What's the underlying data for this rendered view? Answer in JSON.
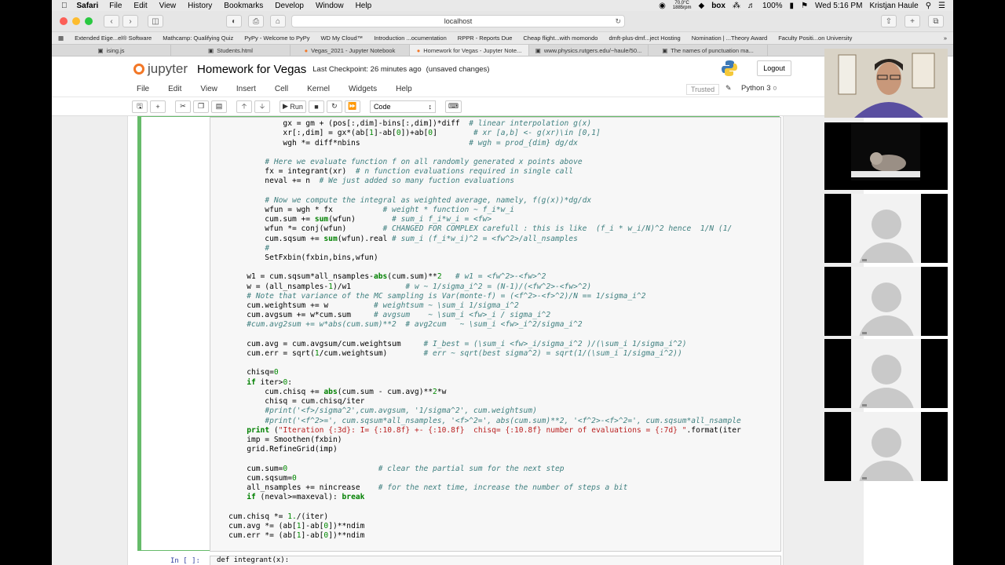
{
  "os_menubar": {
    "app": "Safari",
    "items": [
      "File",
      "Edit",
      "View",
      "History",
      "Bookmarks",
      "Develop",
      "Window",
      "Help"
    ],
    "temp": "70.0°C",
    "rpm": "1885rpm",
    "battery": "100%",
    "clock": "Wed 5:16 PM",
    "user": "Kristjan Haule"
  },
  "browser": {
    "url": "localhost",
    "bookmarks": [
      "Extended Eige...el® Software",
      "Mathcamp: Qualifying Quiz",
      "PyPy - Welcome to PyPy",
      "WD My Cloud™",
      "Introduction ...ocumentation",
      "RPPR - Reports Due",
      "Cheap flight...with momondo",
      "dmft-plus-dmf...ject Hosting",
      "Nomination | ...Theory Award",
      "Faculty Positi...on University"
    ],
    "tabs": [
      "ising.js",
      "Students.html",
      "Vegas_2021 - Jupyter Notebook",
      "Homework for Vegas - Jupyter Note...",
      "www.physics.rutgers.edu/~haule/50...",
      "The names of punctuation ma..."
    ]
  },
  "jupyter": {
    "logo_text": "jupyter",
    "title": "Homework for Vegas",
    "checkpoint": "Last Checkpoint: 26 minutes ago",
    "unsaved": "(unsaved changes)",
    "logout": "Logout",
    "menu": [
      "File",
      "Edit",
      "View",
      "Insert",
      "Cell",
      "Kernel",
      "Widgets",
      "Help"
    ],
    "trusted": "Trusted",
    "kernel": "Python 3",
    "run_label": "Run",
    "cell_type": "Code",
    "next_prompt": "In [ ]:",
    "next_code": "def integrant(x):"
  }
}
